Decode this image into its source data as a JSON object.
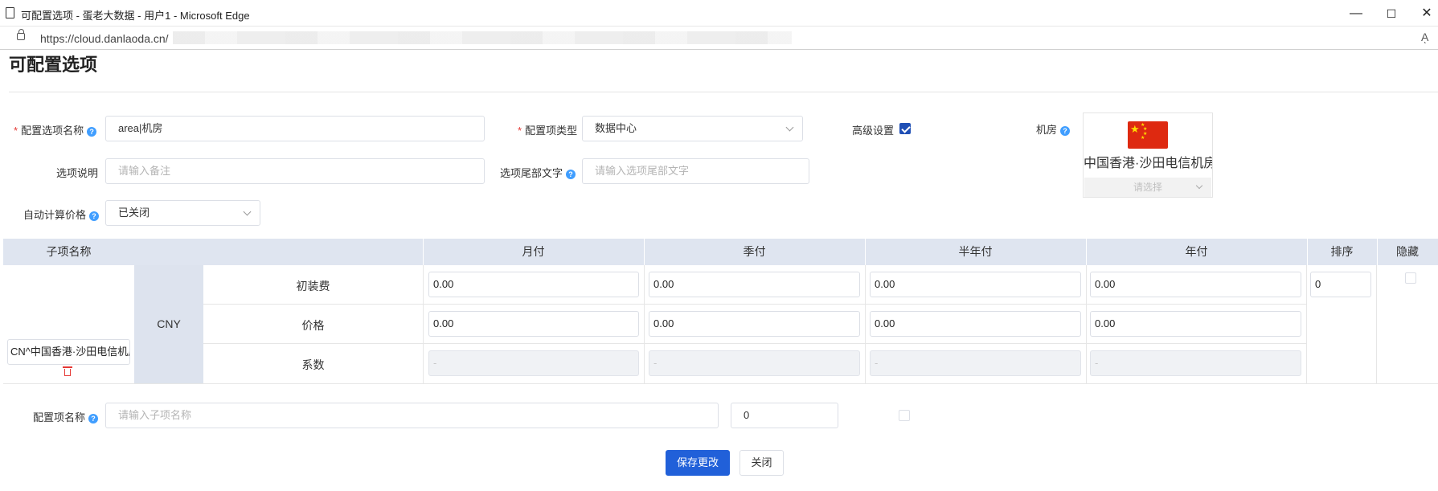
{
  "browser": {
    "tab_title": "可配置选项 - 蛋老大数据 - 用户1 - Microsoft Edge",
    "url": "https://cloud.danlaoda.cn/",
    "reader_glyph": "Aͅ",
    "minimize": "—",
    "maximize": "☐",
    "close": "✕"
  },
  "page": {
    "title": "可配置选项"
  },
  "form": {
    "option_name_label": "配置选项名称",
    "option_name_value": "area|机房",
    "option_type_label": "配置项类型",
    "option_type_value": "数据中心",
    "advanced_label": "高级设置",
    "advanced_checked": true,
    "datacenter_label": "机房",
    "description_label": "选项说明",
    "description_placeholder": "请输入备注",
    "suffix_label": "选项尾部文字",
    "suffix_placeholder": "请输入选项尾部文字",
    "auto_price_label": "自动计算价格",
    "auto_price_value": "已关闭",
    "required_mark": "*",
    "help_glyph": "?"
  },
  "datacenter_card": {
    "name": "中国香港·沙田电信机房",
    "select_placeholder": "请选择",
    "flag_color": "#de2910",
    "star_color": "#ffde00"
  },
  "table": {
    "headers": {
      "name": "子项名称",
      "monthly": "月付",
      "quarterly": "季付",
      "semiannual": "半年付",
      "annual": "年付",
      "sort": "排序",
      "hidden": "隐藏"
    },
    "row": {
      "name_value": "CN^中国香港·沙田电信机房",
      "currency": "CNY",
      "sort_value": "0",
      "sub_rows": [
        {
          "label": "初装费",
          "values": [
            "0.00",
            "0.00",
            "0.00",
            "0.00"
          ]
        },
        {
          "label": "价格",
          "values": [
            "0.00",
            "0.00",
            "0.00",
            "0.00"
          ]
        },
        {
          "label": "系数",
          "values": [
            "-",
            "-",
            "-",
            "-"
          ]
        }
      ]
    }
  },
  "add_row": {
    "label": "配置项名称",
    "name_placeholder": "请输入子项名称",
    "sort_value": "0"
  },
  "buttons": {
    "save": "保存更改",
    "close": "关闭"
  },
  "colors": {
    "primary": "#2160d9",
    "header_bg": "#dfe5f0",
    "help": "#409eff",
    "required": "#e53935"
  }
}
